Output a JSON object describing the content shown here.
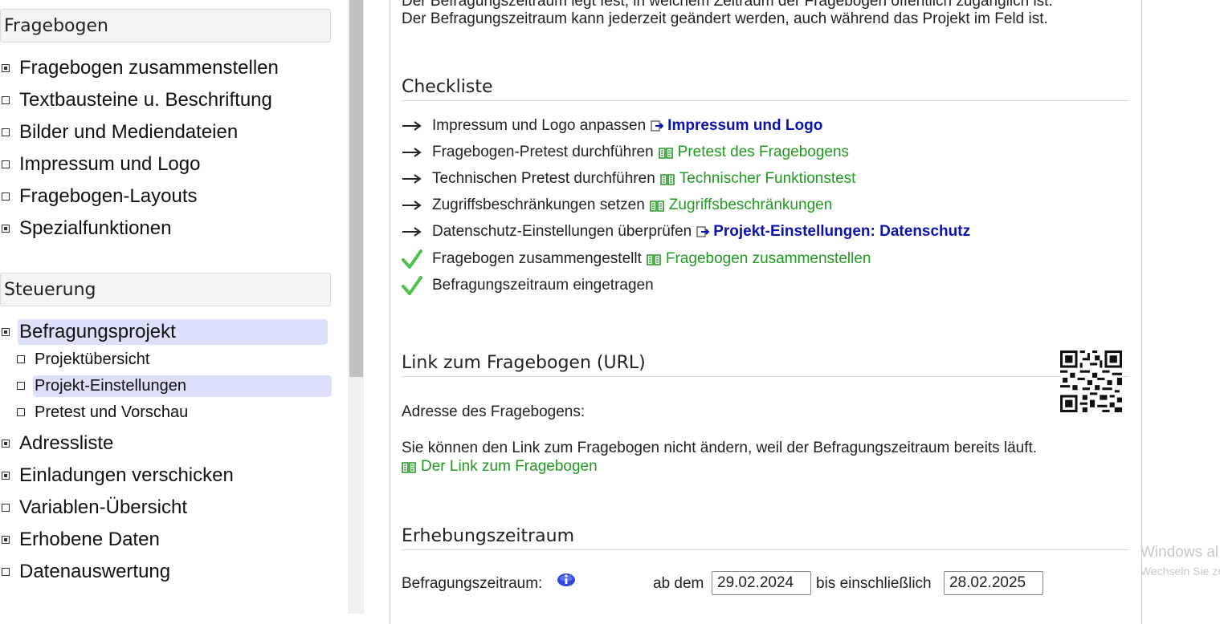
{
  "sidebar": {
    "fragebogen_header": "Fragebogen",
    "fragebogen_items": [
      {
        "label": "Fragebogen zusammenstellen",
        "expand": "plus"
      },
      {
        "label": "Textbausteine u. Beschriftung",
        "expand": "square"
      },
      {
        "label": "Bilder und Mediendateien",
        "expand": "square"
      },
      {
        "label": "Impressum und Logo",
        "expand": "square"
      },
      {
        "label": "Fragebogen-Layouts",
        "expand": "square"
      },
      {
        "label": "Spezialfunktionen",
        "expand": "plus"
      }
    ],
    "steuerung_header": "Steuerung",
    "befragungsprojekt": "Befragungsprojekt",
    "sub_items": [
      "Projektübersicht",
      "Projekt-Einstellungen",
      "Pretest und Vorschau"
    ],
    "steuerung_items": [
      {
        "label": "Adressliste",
        "expand": "plus"
      },
      {
        "label": "Einladungen verschicken",
        "expand": "plus"
      },
      {
        "label": "Variablen-Übersicht",
        "expand": "square"
      },
      {
        "label": "Erhobene Daten",
        "expand": "plus"
      },
      {
        "label": "Datenauswertung",
        "expand": "square"
      }
    ]
  },
  "main": {
    "intro_line1": "Der Befragungszeitraum legt fest, in welchem Zeitraum der Fragebogen öffentlich zugänglich ist.",
    "intro_line2": "Der Befragungszeitraum kann jederzeit geändert werden, auch während das Projekt im Feld ist.",
    "checklist_title": "Checkliste",
    "checklist": [
      {
        "status": "todo",
        "text": "Impressum und Logo anpassen",
        "link": "Impressum und Logo",
        "link_type": "internal"
      },
      {
        "status": "todo",
        "text": "Fragebogen-Pretest durchführen",
        "link": "Pretest des Fragebogens",
        "link_type": "help"
      },
      {
        "status": "todo",
        "text": "Technischen Pretest durchführen",
        "link": "Technischer Funktionstest",
        "link_type": "help"
      },
      {
        "status": "todo",
        "text": "Zugriffsbeschränkungen setzen",
        "link": "Zugriffsbeschränkungen",
        "link_type": "help"
      },
      {
        "status": "todo",
        "text": "Datenschutz-Einstellungen überprüfen",
        "link": "Projekt-Einstellungen: Datenschutz",
        "link_type": "internal"
      },
      {
        "status": "done",
        "text": "Fragebogen zusammengestellt",
        "link": "Fragebogen zusammenstellen",
        "link_type": "help"
      },
      {
        "status": "done",
        "text": "Befragungszeitraum eingetragen",
        "link": "",
        "link_type": "none"
      }
    ],
    "link_title": "Link zum Fragebogen (URL)",
    "address_label": "Adresse des Fragebogens:",
    "link_notice": "Sie können den Link zum Fragebogen nicht ändern, weil der Befragungszeitraum bereits läuft.",
    "link_help": "Der Link zum Fragebogen",
    "erhebung_title": "Erhebungszeitraum",
    "period_label": "Befragungszeitraum:",
    "from_label": "ab dem",
    "from_value": "29.02.2024",
    "to_label": "bis einschließlich",
    "to_value": "28.02.2025"
  },
  "watermark": {
    "line1": "Windows al",
    "line2": "Wechseln Sie zu"
  },
  "colors": {
    "active_bg": "#dde0fb",
    "link_blue": "#0a12b0",
    "link_green": "#229922",
    "tick_green": "#4cc24c"
  }
}
